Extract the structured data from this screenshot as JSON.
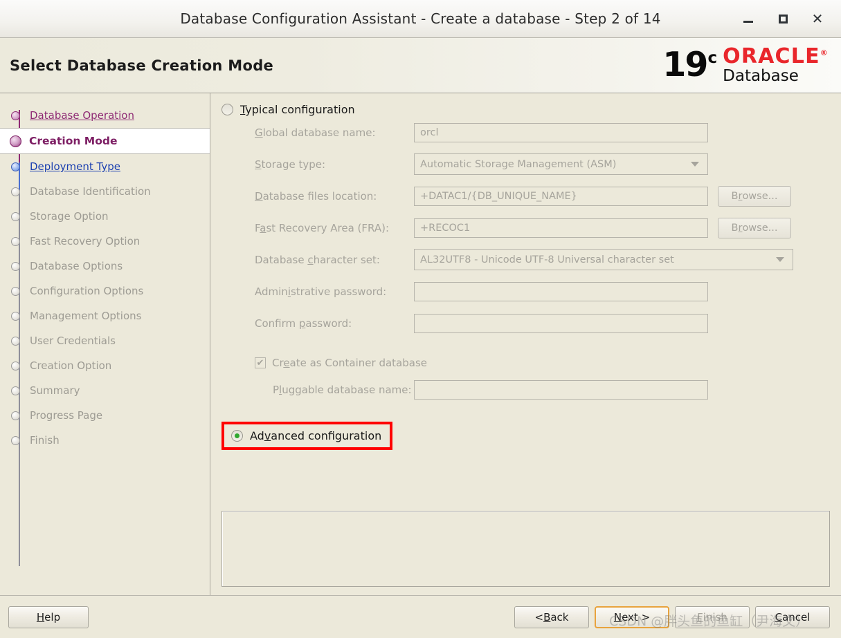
{
  "window": {
    "title": "Database Configuration Assistant - Create a database - Step 2 of 14",
    "minimize_label": "–",
    "maximize_label": "",
    "close_label": "✕"
  },
  "header": {
    "page_title": "Select Database Creation Mode",
    "logo": {
      "version": "19",
      "version_sup": "c",
      "brand": "ORACLE",
      "brand_sup": "®",
      "product": "Database"
    }
  },
  "sidebar": {
    "items": [
      {
        "label": "Database Operation",
        "state": "done"
      },
      {
        "label": "Creation Mode",
        "state": "current"
      },
      {
        "label": "Deployment Type",
        "state": "next"
      },
      {
        "label": "Database Identification",
        "state": "pending"
      },
      {
        "label": "Storage Option",
        "state": "pending"
      },
      {
        "label": "Fast Recovery Option",
        "state": "pending"
      },
      {
        "label": "Database Options",
        "state": "pending"
      },
      {
        "label": "Configuration Options",
        "state": "pending"
      },
      {
        "label": "Management Options",
        "state": "pending"
      },
      {
        "label": "User Credentials",
        "state": "pending"
      },
      {
        "label": "Creation Option",
        "state": "pending"
      },
      {
        "label": "Summary",
        "state": "pending"
      },
      {
        "label": "Progress Page",
        "state": "pending"
      },
      {
        "label": "Finish",
        "state": "pending"
      }
    ]
  },
  "main": {
    "typical": {
      "label_pre": "",
      "mnemonic": "T",
      "label_post": "ypical configuration",
      "selected": false
    },
    "fields": [
      {
        "label_pre": "",
        "mnemonic": "G",
        "label_post": "lobal database name:",
        "value": "orcl",
        "type": "text",
        "width": "std",
        "browse": false
      },
      {
        "label_pre": "",
        "mnemonic": "S",
        "label_post": "torage type:",
        "value": "Automatic Storage Management (ASM)",
        "type": "select",
        "width": "std",
        "browse": false
      },
      {
        "label_pre": "",
        "mnemonic": "D",
        "label_post": "atabase files location:",
        "value": "+DATAC1/{DB_UNIQUE_NAME}",
        "type": "text",
        "width": "std",
        "browse": true
      },
      {
        "label_pre": "F",
        "mnemonic": "a",
        "label_post": "st Recovery Area (FRA):",
        "value": "+RECOC1",
        "type": "text",
        "width": "std",
        "browse": true
      },
      {
        "label_pre": "Database ",
        "mnemonic": "c",
        "label_post": "haracter set:",
        "value": "AL32UTF8 - Unicode UTF-8 Universal character set",
        "type": "select",
        "width": "wide",
        "browse": false
      },
      {
        "label_pre": "Admin",
        "mnemonic": "i",
        "label_post": "strative password:",
        "value": "",
        "type": "password",
        "width": "std",
        "browse": false
      },
      {
        "label_pre": "Confirm ",
        "mnemonic": "p",
        "label_post": "assword:",
        "value": "",
        "type": "password",
        "width": "std",
        "browse": false
      }
    ],
    "browse_button": {
      "label_pre": "B",
      "mnemonic": "r",
      "label_post": "owse..."
    },
    "container_db": {
      "label_pre": "Cr",
      "mnemonic": "e",
      "label_post": "ate as Container database",
      "checked": true,
      "check_glyph": "✔"
    },
    "pluggable_db": {
      "label_pre": "P",
      "mnemonic": "l",
      "label_post": "uggable database name:",
      "value": ""
    },
    "advanced": {
      "label_pre": "Ad",
      "mnemonic": "v",
      "label_post": "anced configuration",
      "selected": true,
      "highlight_color": "#FF0000"
    },
    "message_panel": {
      "text": ""
    }
  },
  "footer": {
    "help": {
      "label_pre": "",
      "mnemonic": "H",
      "label_post": "elp"
    },
    "back": {
      "label_pre": "< ",
      "mnemonic": "B",
      "label_post": "ack"
    },
    "next": {
      "label_pre": "",
      "mnemonic": "N",
      "label_post": "ext >",
      "focused": true
    },
    "finish": {
      "label_pre": "",
      "mnemonic": "F",
      "label_post": "inish",
      "enabled": false
    },
    "cancel": {
      "label_pre": "",
      "mnemonic": "C",
      "label_post": "ancel"
    }
  },
  "watermark": {
    "text": "CSDN @胖头鱼的鱼缸（尹海文）"
  }
}
